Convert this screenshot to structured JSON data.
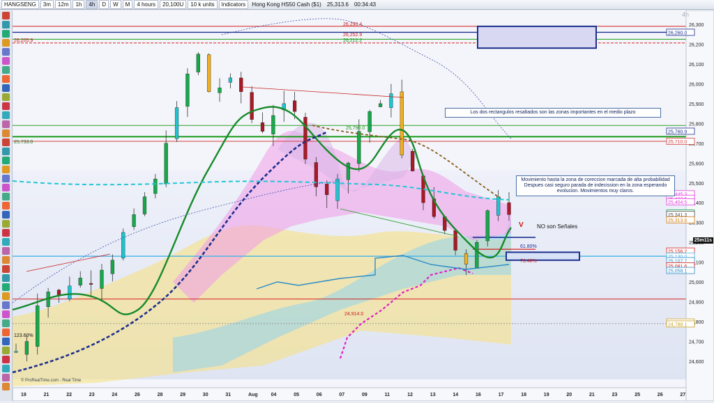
{
  "toolbar": {
    "symbol": "HANGSENG",
    "timeframes": [
      "3m",
      "12m",
      "1h",
      "4h",
      "D",
      "W",
      "M"
    ],
    "period": "4 hours",
    "units": "20,100U",
    "lot": "10 k units",
    "indicators": "Indicators",
    "instrument": "Hong Kong HS50 Cash ($1)",
    "price": "25,313.6",
    "time": "00:34:43",
    "timeframe_watermark": "4h"
  },
  "notes": {
    "rectangles": "Los dos rectangulos resaltados son las zonas importantes en el medio plazo",
    "movement": "Movimiento hasta la zona de coreccion marcada de alta probabilidad Despues casi seguro parada de indecission en la zona esperando evolucion. Movimientos muy claros.",
    "no_signals": "NO son Señales",
    "v_mark": "V"
  },
  "levels": {
    "r1": "26,290.4",
    "r2": "26,252.9",
    "r3": "26,212.2",
    "left_r": "26,205.9",
    "left_733": "25,733.0",
    "l1": "25,790.0",
    "bottom": "24,914.0",
    "fib1": "61.80%",
    "fib2": "76.40%",
    "pct_left": "123.60%"
  },
  "price_axis": {
    "ticks": [
      "26,300",
      "26,200",
      "26,100",
      "26,000",
      "25,900",
      "25,800",
      "25,700",
      "25,600",
      "25,500",
      "25,400",
      "25,300",
      "25,200",
      "25,100",
      "25,000",
      "24,900",
      "24,800",
      "24,700",
      "24,600"
    ],
    "tags": [
      "26,260.0",
      "25,760.9",
      "25,710.0",
      "25,445.3",
      "25,422.5",
      "25,404.5",
      "25,347.7",
      "25,341.3",
      "25,313.6",
      "25,156.2",
      "25,130.0",
      "25,107.7",
      "25,081.6",
      "25,058.1",
      "24,798.1",
      "24,788.1"
    ],
    "countdown": "25m11s"
  },
  "date_axis": [
    "19",
    "21",
    "22",
    "23",
    "24",
    "26",
    "28",
    "29",
    "30",
    "31",
    "Aug",
    "04",
    "05",
    "06",
    "07",
    "09",
    "11",
    "12",
    "13",
    "14",
    "16",
    "17",
    "18",
    "19",
    "20",
    "21",
    "23",
    "25",
    "26",
    "27"
  ],
  "footer": "© ProRealTime.com - Real Time",
  "colors": {
    "up": "#17a84a",
    "down": "#b01822",
    "teal": "#18b8c8",
    "magenta": "#e13be0",
    "navy": "#1c2e8c"
  }
}
